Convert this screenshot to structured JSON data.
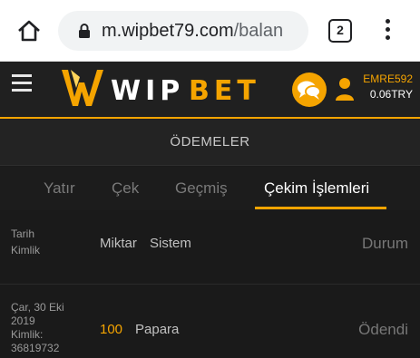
{
  "browser": {
    "url_domain": "m.wipbet79.com",
    "url_path": "/balan",
    "tab_count": "2"
  },
  "site": {
    "logo_text": "WIPBET",
    "username": "EMRE592",
    "balance": "0.06TRY"
  },
  "page": {
    "title": "ÖDEMELER"
  },
  "tabs": [
    {
      "label": "Yatır"
    },
    {
      "label": "Çek"
    },
    {
      "label": "Geçmiş"
    },
    {
      "label": "Çekim İşlemleri"
    }
  ],
  "table": {
    "headers": {
      "date": "Tarih",
      "id": "Kimlik",
      "amount": "Miktar",
      "system": "Sistem",
      "status": "Durum"
    },
    "rows": [
      {
        "date_line1": "Çar, 30 Eki",
        "date_line2": "2019",
        "id_label": "Kimlik:",
        "id_value": "36819732",
        "amount": "100",
        "system": "Papara",
        "status": "Ödendi"
      }
    ]
  },
  "colors": {
    "accent": "#f5a400",
    "background": "#1a1a1a"
  }
}
